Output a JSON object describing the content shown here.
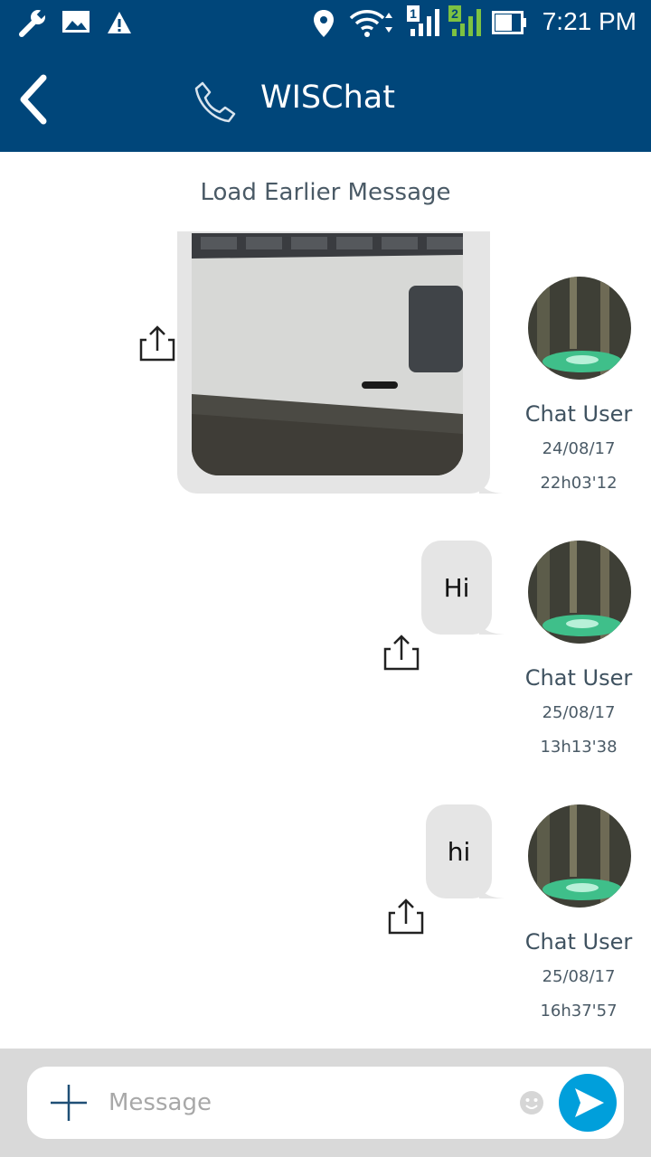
{
  "status_bar": {
    "time": "7:21 PM",
    "icons": [
      "wrench-icon",
      "image-icon",
      "warning-icon",
      "location-icon",
      "wifi-icon",
      "sim1-signal-icon",
      "sim2-signal-icon",
      "battery-icon"
    ],
    "sim1_label": "1",
    "sim2_label": "2"
  },
  "app_bar": {
    "title": "WISChat",
    "color": "#00467a"
  },
  "chat": {
    "load_earlier": "Load Earlier Message",
    "messages": [
      {
        "type": "image",
        "sender": "Chat User",
        "date": "24/08/17",
        "time": "22h03'12"
      },
      {
        "type": "text",
        "text": "Hi",
        "sender": "Chat User",
        "date": "25/08/17",
        "time": "13h13'38"
      },
      {
        "type": "text",
        "text": "hi",
        "sender": "Chat User",
        "date": "25/08/17",
        "time": "16h37'57"
      }
    ]
  },
  "composer": {
    "placeholder": "Message",
    "value": "",
    "send_color": "#009fdb"
  }
}
